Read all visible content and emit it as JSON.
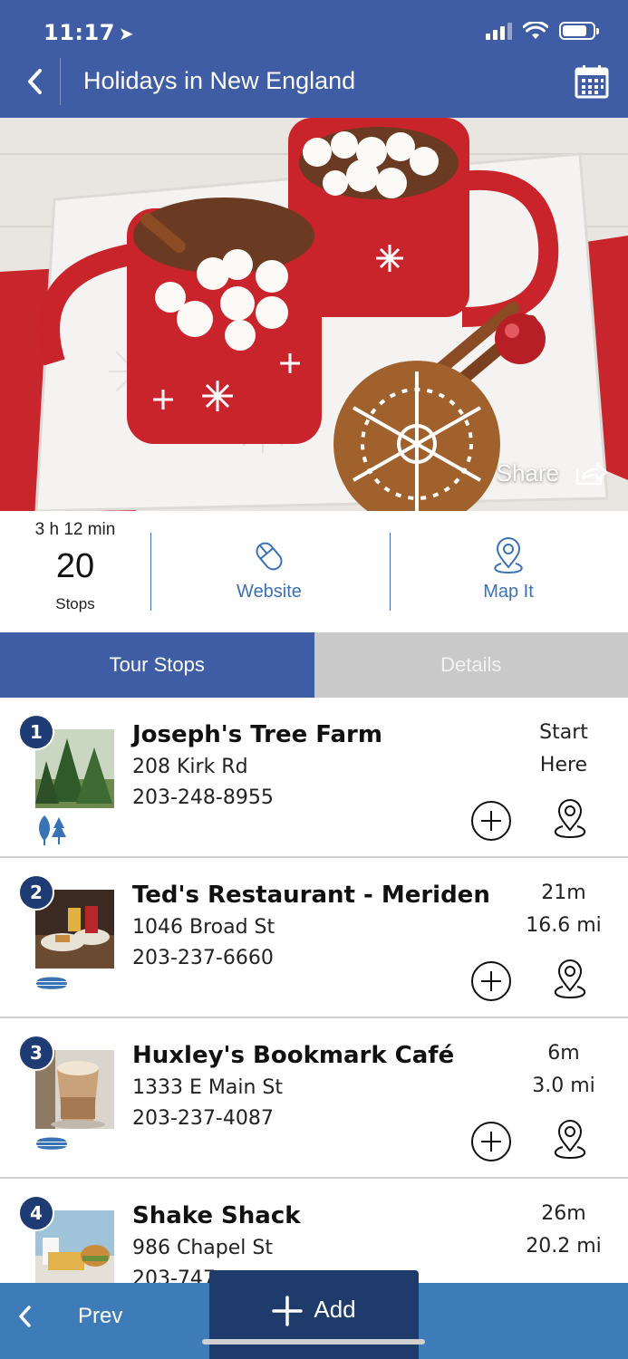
{
  "status_bar": {
    "time": "11:17"
  },
  "nav": {
    "title": "Holidays in New England"
  },
  "hero": {
    "share_label": "Share"
  },
  "summary": {
    "duration": "3 h 12 min",
    "stop_count": "20",
    "stop_unit": "Stops",
    "website_label": "Website",
    "map_label": "Map It"
  },
  "tabs": [
    {
      "label": "Tour Stops",
      "active": true
    },
    {
      "label": "Details",
      "active": false
    }
  ],
  "stops": [
    {
      "number": "1",
      "name": "Joseph's Tree Farm",
      "address": "208 Kirk Rd",
      "phone": "203-248-8955",
      "time": "Start",
      "distance": "Here",
      "category_icon": "tree-icon"
    },
    {
      "number": "2",
      "name": "Ted's Restaurant - Meriden",
      "address": "1046 Broad St",
      "phone": "203-237-6660",
      "time": "21m",
      "distance": "16.6 mi",
      "category_icon": "food-icon"
    },
    {
      "number": "3",
      "name": "Huxley's Bookmark Café",
      "address": "1333 E Main St",
      "phone": "203-237-4087",
      "time": "6m",
      "distance": "3.0 mi",
      "category_icon": "food-icon"
    },
    {
      "number": "4",
      "name": "Shake Shack",
      "address": "986 Chapel St",
      "phone": "203-747",
      "time": "26m",
      "distance": "20.2 mi",
      "category_icon": "food-icon"
    }
  ],
  "bottom_bar": {
    "prev_label": "Prev",
    "add_label": "Add"
  },
  "colors": {
    "primary": "#3f5da4",
    "accent": "#3a72b6",
    "dark": "#1f3b6b",
    "bottom": "#3d7cb8"
  }
}
